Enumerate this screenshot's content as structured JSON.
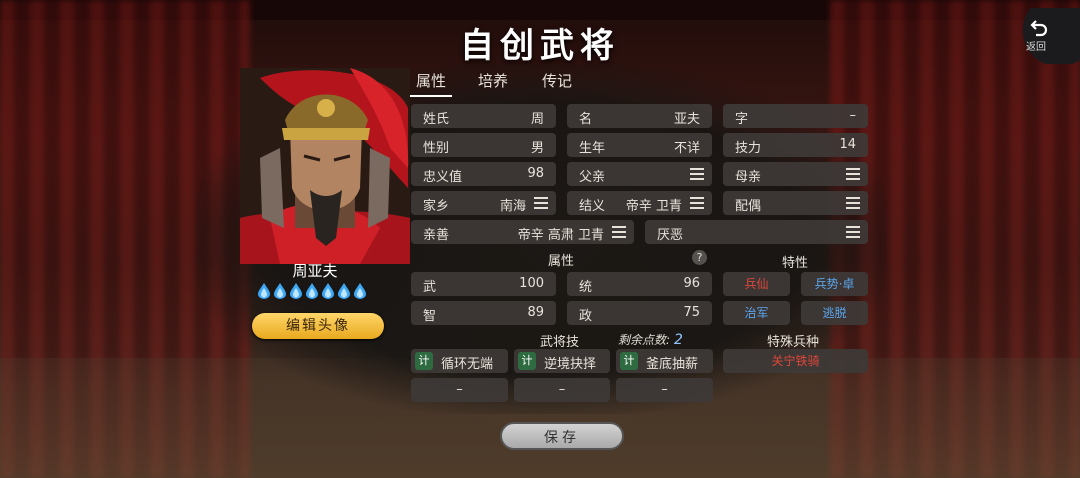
{
  "title": "自创武将",
  "back_label": "返回",
  "tabs": [
    "属性",
    "培养",
    "传记"
  ],
  "hero": {
    "name": "周亚夫",
    "gem_count": 7,
    "edit_label": "编辑头像"
  },
  "info": {
    "surname": {
      "label": "姓氏",
      "value": "周"
    },
    "given_name": {
      "label": "名",
      "value": "亚夫"
    },
    "courtesy": {
      "label": "字",
      "value": "–"
    },
    "gender": {
      "label": "性别",
      "value": "男"
    },
    "birth_year": {
      "label": "生年",
      "value": "不详"
    },
    "skill_power": {
      "label": "技力",
      "value": "14"
    },
    "loyalty": {
      "label": "忠义值",
      "value": "98"
    },
    "father": {
      "label": "父亲",
      "value": ""
    },
    "mother": {
      "label": "母亲",
      "value": ""
    },
    "hometown": {
      "label": "家乡",
      "value": "南海"
    },
    "sworn": {
      "label": "结义",
      "value": "帝辛 卫青"
    },
    "spouse": {
      "label": "配偶",
      "value": ""
    },
    "likes": {
      "label": "亲善",
      "value": "帝辛 高肃 卫青"
    },
    "dislikes": {
      "label": "厌恶",
      "value": ""
    }
  },
  "attributes": {
    "title": "属性",
    "help": "?",
    "items": [
      {
        "label": "武",
        "value": "100"
      },
      {
        "label": "统",
        "value": "96"
      },
      {
        "label": "智",
        "value": "89"
      },
      {
        "label": "政",
        "value": "75"
      }
    ]
  },
  "traits": {
    "title": "特性",
    "items": [
      {
        "label": "兵仙",
        "color": "#e0463a"
      },
      {
        "label": "兵势·卓",
        "color": "#5aa6ee"
      },
      {
        "label": "治军",
        "color": "#5aa6ee"
      },
      {
        "label": "逃脱",
        "color": "#5aa6ee"
      }
    ]
  },
  "skills": {
    "title": "武将技",
    "points_label": "剩余点数:",
    "points": "2",
    "items": [
      {
        "badge": "计",
        "name": "循环无端"
      },
      {
        "badge": "计",
        "name": "逆境抉择"
      },
      {
        "badge": "计",
        "name": "釜底抽薪"
      }
    ],
    "empty": [
      "–",
      "–",
      "–"
    ]
  },
  "special_troop": {
    "title": "特殊兵种",
    "value": "关宁铁骑",
    "color": "#e0463a"
  },
  "save_label": "保存"
}
